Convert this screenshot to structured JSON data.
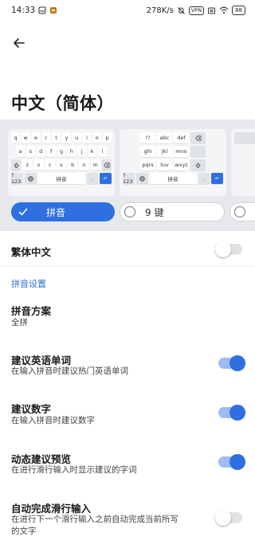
{
  "status_bar": {
    "time": "14:33",
    "net_speed": "278K/s",
    "vpn": "VPN",
    "battery": "88"
  },
  "page": {
    "title": "中文（简体）"
  },
  "keyboards": {
    "qwerty_rows": [
      [
        "q",
        "w",
        "e",
        "r",
        "t",
        "y",
        "u",
        "i",
        "o",
        "p"
      ],
      [
        "a",
        "s",
        "d",
        "f",
        "g",
        "h",
        "j",
        "k",
        "l"
      ],
      [
        "z",
        "x",
        "c",
        "v",
        "b",
        "n",
        "m"
      ]
    ],
    "t9_rows": [
      [
        "!?",
        "abc",
        "def"
      ],
      [
        "ghi",
        "jkl",
        "mno"
      ],
      [
        "pqrs",
        "tuv",
        "wxyz"
      ]
    ],
    "num_key": "?123",
    "comma_key": ",",
    "period_key": ".",
    "lang_key": "拼音",
    "enter_key": "↵",
    "options": [
      {
        "label": "拼音",
        "selected": true
      },
      {
        "label": "9 键",
        "selected": false
      },
      {
        "label": "",
        "selected": false
      }
    ]
  },
  "settings": {
    "traditional": {
      "title": "繁体中文",
      "enabled": false
    },
    "pinyin_section": "拼音设置",
    "scheme": {
      "title": "拼音方案",
      "value": "全拼"
    },
    "suggest_english": {
      "title": "建议英语单词",
      "desc": "在输入拼音时建议热门英语单词",
      "enabled": true
    },
    "suggest_numbers": {
      "title": "建议数字",
      "desc": "在输入拼音时建议数字",
      "enabled": true
    },
    "gesture_preview": {
      "title": "动态建议预览",
      "desc": "在进行滑行输入时显示建议的字词",
      "enabled": true
    },
    "auto_complete": {
      "title": "自动完成滑行输入",
      "desc_line1": "在进行下一个滑行输入之前自动完成当前所写",
      "desc_line2": "的文字",
      "enabled": false
    }
  },
  "colors": {
    "accent": "#2f6fe0",
    "keyboard_bg": "#e6e8eb"
  }
}
